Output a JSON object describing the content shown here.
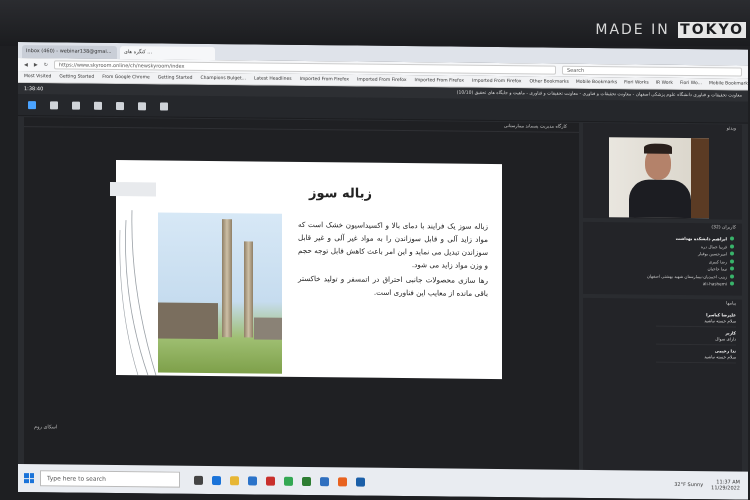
{
  "brand": {
    "made_in": "MADE IN",
    "tokyo": "TOKYO"
  },
  "browser": {
    "tabs": [
      "Inbox (460) - webinar138@gmai...",
      "کنگره های ..."
    ],
    "url": "https://www.skyroom.online/ch/newskyroom/index",
    "search_placeholder": "Search",
    "bookmarks_left": [
      "Most Visited",
      "Getting Started",
      "From Google Chrome",
      "Getting Started",
      "Champions Bulget...",
      "Latest Headlines",
      "Imported From Firefox",
      "Imported From Firefox",
      "Imported From Firefox",
      "Imported From Firefox"
    ],
    "bookmarks_right": [
      "Other Bookmarks",
      "Mobile Bookmarks",
      "Fiori Works",
      "IR Work",
      "Fiori Wo...",
      "Mobile Bookmarks"
    ]
  },
  "app": {
    "elapsed": "1:38:40",
    "title": "معاونت تحقیقات و فناوری دانشگاه علوم پزشکی اصفهان - معاونت تحقیقات و فناوری - معاونت تحقیقات و فناوری - ماهیت و جایگاه های تحقیق (10/10)",
    "presentation_header": "کارگاه مدیریت پسماند بیمارستانی",
    "watermark": "اسکای روم"
  },
  "slide": {
    "title": "زباله سوز",
    "paragraph1": "زباله سوز یک فرایند با دمای بالا و اکسیداسیون خشک است که مواد زاید آلی و قابل سوزاندن را به مواد غیر آلی و غیر قابل سوزاندن تبدیل می نماید و این امر باعث کاهش قابل توجه حجم و وزن مواد زاید می شود.",
    "paragraph2": "رها سازی محصولات جانبی احتراق در اتمسفر و تولید خاکستر باقی مانده از معایب این فناوری است."
  },
  "side": {
    "video_header": "ویدئو",
    "attendees_header": "کاربران",
    "attendees_count": "32",
    "attendees": [
      "ابراهیم دانشکده بهداشت",
      "فریبا جمال دره",
      "امیرحسین بوقبار",
      "رضا کبیری",
      "نیما حاجیان",
      "زینب احمدیان-بیمارستان شهید بهشتی اصفهان",
      "ali-hashemi"
    ],
    "chat_header": "پیامها",
    "chat_messages": [
      {
        "sender": "علیرضا کیاسرا",
        "text": "سلام خسته نباشید"
      },
      {
        "sender": "کاربر",
        "text": "دارای سوال"
      },
      {
        "sender": "ندا رحیمی",
        "text": "سلام خسته نباشید"
      }
    ]
  },
  "taskbar": {
    "search_placeholder": "Type here to search",
    "weather": "32°F Sunny",
    "time": "11:37 AM",
    "date": "11/29/2022"
  }
}
